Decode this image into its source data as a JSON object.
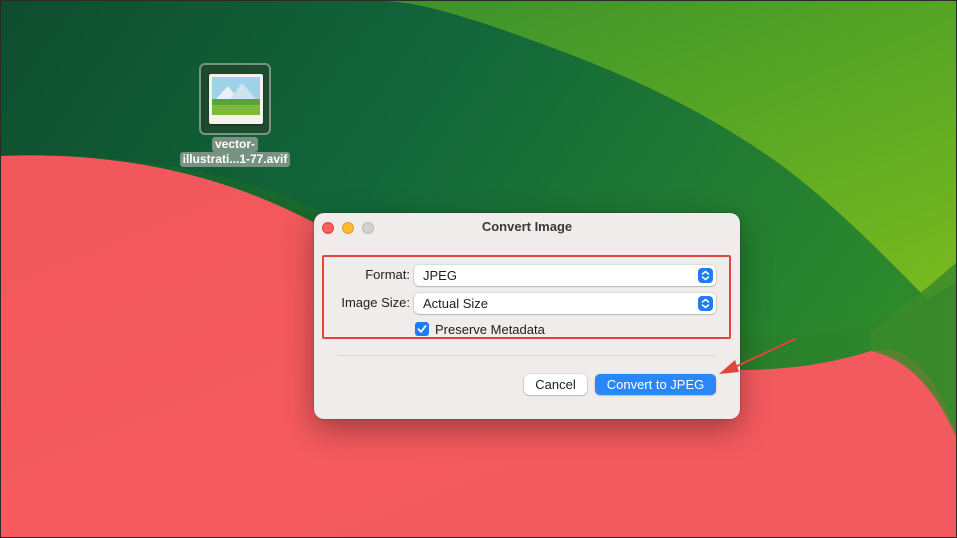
{
  "desktop": {
    "file": {
      "name_line1": "vector-",
      "name_line2": "illustrati...1-77.avif"
    }
  },
  "dialog": {
    "title": "Convert Image",
    "format": {
      "label": "Format:",
      "value": "JPEG"
    },
    "image_size": {
      "label": "Image Size:",
      "value": "Actual Size"
    },
    "preserve_metadata": {
      "label": "Preserve Metadata",
      "checked": true
    },
    "cancel_label": "Cancel",
    "convert_label": "Convert to JPEG"
  },
  "colors": {
    "accent": "#2b86f7",
    "highlight": "#e2453b",
    "close": "#fe5f57",
    "minimize": "#febc2e"
  }
}
